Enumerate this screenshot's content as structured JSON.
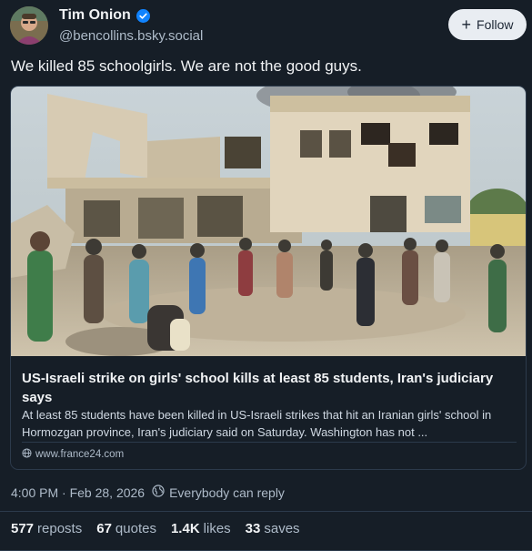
{
  "author": {
    "display_name": "Tim Onion",
    "handle": "@bencollins.bsky.social",
    "verified_icon": "verified-check-icon",
    "avatar_icon": "avatar"
  },
  "follow": {
    "plus": "+",
    "label": "Follow"
  },
  "post": {
    "text": "We killed 85 schoolgirls. We are not the good guys."
  },
  "link_card": {
    "image_icon": "bombed-school-photo",
    "title": "US-Israeli strike on girls' school kills at least 85 students, Iran's judiciary says",
    "description": "At least 85 students have been killed in US-Israeli strikes that hit an Iranian girls' school in Hormozgan province, Iran's judiciary said on Saturday. Washington has not ...",
    "domain": "www.france24.com",
    "domain_icon": "globe-icon"
  },
  "meta": {
    "timestamp": "4:00 PM · Feb 28, 2026",
    "reply_setting": "Everybody can reply",
    "reply_icon": "earth-icon"
  },
  "stats": {
    "reposts_count": "577",
    "reposts_label": "reposts",
    "quotes_count": "67",
    "quotes_label": "quotes",
    "likes_count": "1.4K",
    "likes_label": "likes",
    "saves_count": "33",
    "saves_label": "saves"
  },
  "colors": {
    "background": "#161e27",
    "verified": "#1083fe",
    "follow_button_bg": "#e9edf2",
    "border": "#2c3a4b"
  }
}
